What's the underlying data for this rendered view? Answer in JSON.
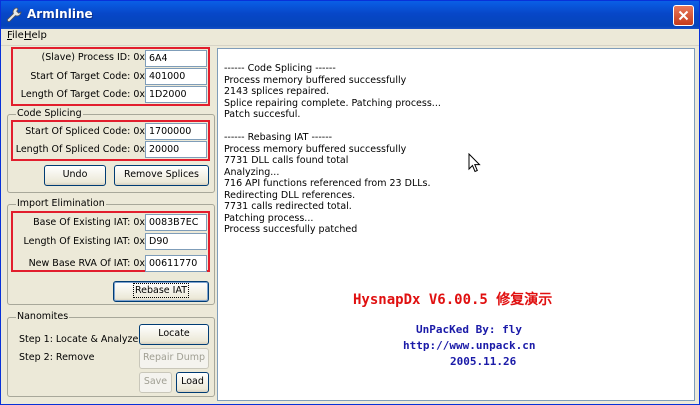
{
  "window": {
    "title": "ArmInline"
  },
  "menu": {
    "file": "File",
    "help": "Help"
  },
  "slave": {
    "process_id_label": "(Slave) Process ID: 0x",
    "process_id_value": "6A4",
    "start_code_label": "Start Of Target Code: 0x",
    "start_code_value": "401000",
    "length_code_label": "Length Of Target Code: 0x",
    "length_code_value": "1D2000"
  },
  "code_splicing": {
    "title": "Code Splicing",
    "start_label": "Start Of Spliced Code: 0x",
    "start_value": "1700000",
    "length_label": "Length Of Spliced Code: 0x",
    "length_value": "20000",
    "undo_label": "Undo",
    "remove_label": "Remove Splices"
  },
  "import_elimination": {
    "title": "Import Elimination",
    "base_iat_label": "Base Of Existing IAT: 0x",
    "base_iat_value": "0083B7EC",
    "length_iat_label": "Length Of Existing IAT: 0x",
    "length_iat_value": "D90",
    "new_base_label": "New Base RVA Of IAT: 0x",
    "new_base_value": "00611770",
    "rebase_label": "Rebase IAT"
  },
  "nanomites": {
    "title": "Nanomites",
    "step1": "Step 1:  Locate & Analyze",
    "step2": "Step 2:  Remove",
    "locate_label": "Locate",
    "repair_label": "Repair Dump",
    "save_label": "Save",
    "load_label": "Load"
  },
  "log": {
    "lines": [
      "------ Code Splicing ------",
      "Process memory buffered successfully",
      "2143 splices repaired.",
      "Splice repairing complete. Patching process...",
      "Patch succesful.",
      "",
      "------ Rebasing IAT ------",
      "Process memory buffered successfully",
      "7731 DLL calls found total",
      "Analyzing...",
      "716 API functions referenced from 23 DLLs.",
      "Redirecting DLL references.",
      "7731 calls redirected total.",
      "Patching process...",
      "Process succesfully patched"
    ]
  },
  "credits": {
    "title": "HysnapDx V6.00.5 修复演示",
    "author": "UnPacKed By:  fly",
    "url": "http://www.unpack.cn",
    "date": "2005.11.26"
  },
  "colors": {
    "highlight_box": "#e21e2d",
    "credit_title": "#e01010",
    "credit_text": "#1a1aa8"
  }
}
